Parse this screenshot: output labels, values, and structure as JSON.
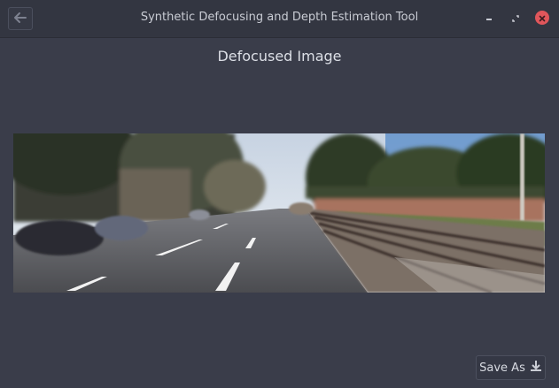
{
  "window": {
    "title": "Synthetic Defocusing and Depth Estimation Tool",
    "close_color": "#e0565b"
  },
  "icons": {
    "back": "arrow-left-icon",
    "minimize": "minimize-icon",
    "maximize": "maximize-icon",
    "close": "close-icon",
    "download": "download-icon"
  },
  "main": {
    "heading": "Defocused Image"
  },
  "actions": {
    "save_label": "Save As"
  }
}
